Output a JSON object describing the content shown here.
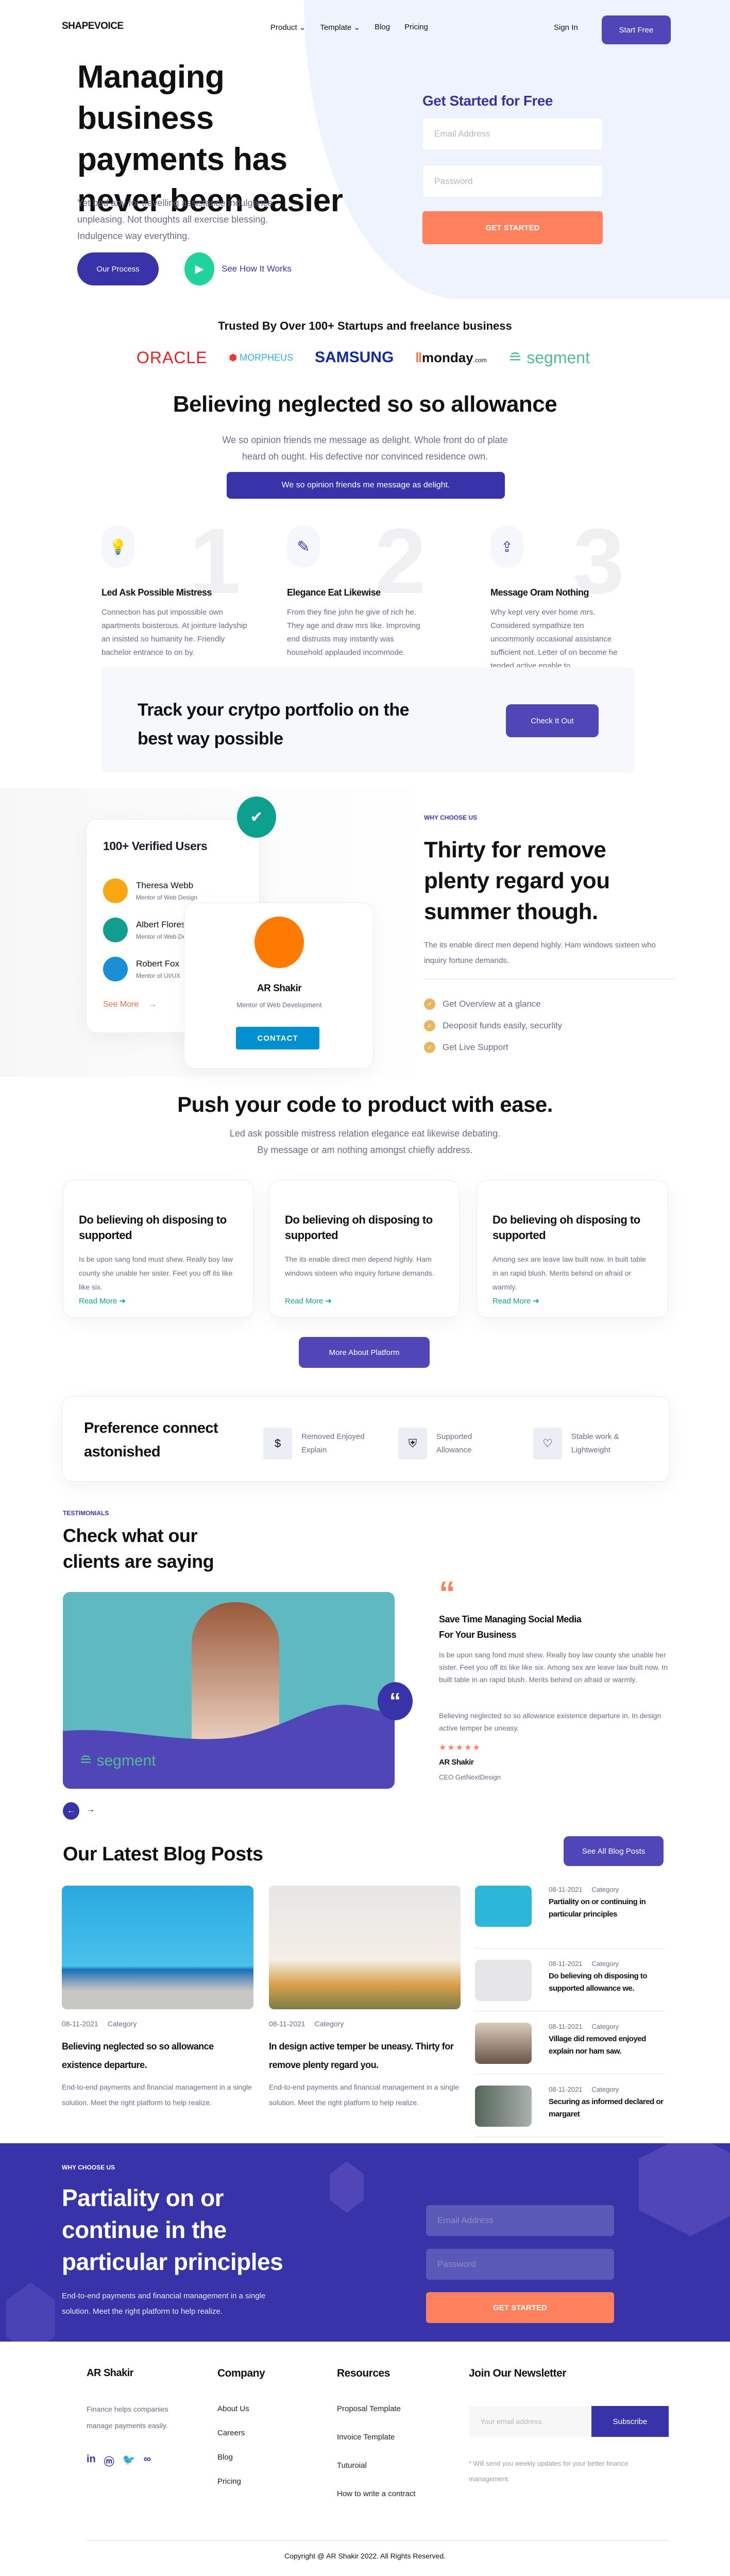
{
  "nav": {
    "logo": "SHAPEVOICE",
    "items": [
      "Product",
      "Template",
      "Blog",
      "Pricing"
    ],
    "sign_in": "Sign In",
    "start_free": "Start Free"
  },
  "hero": {
    "title": "Managing business payments has never been easier",
    "desc": "Yet bed any for travelling assistance indulgence unpleasing. Not thoughts all exercise blessing. Indulgence way everything.",
    "our_process": "Our Process",
    "see_how": "See How It Works",
    "form": {
      "title": "Get Started for Free",
      "email_placeholder": "Email Address",
      "password_placeholder": "Password",
      "submit": "GET STARTED"
    }
  },
  "trusted": {
    "title": "Trusted By Over 100+ Startups and freelance business",
    "logos": [
      "ORACLE",
      "MORPHEUS",
      "SAMSUNG",
      "monday",
      "segment"
    ],
    "logo_suffix": ".com"
  },
  "believing": {
    "title": "Believing neglected so so allowance",
    "desc": "We so opinion friends me message as delight. Whole front do of plate heard oh ought. His defective nor convinced residence own.",
    "button": "We so opinion friends me message as delight.",
    "features": [
      {
        "num": "1",
        "title": "Led Ask Possible Mistress",
        "text": "Connection has put impossible own apartments boisterous. At jointure ladyship an insisted so humanity he. Friendly bachelor entrance to on by."
      },
      {
        "num": "2",
        "title": "Elegance Eat Likewise",
        "text": "From they fine john he give of rich he. They age and draw mrs like. Improving end distrusts may instantly was household applauded incommode."
      },
      {
        "num": "3",
        "title": "Message Oram Nothing",
        "text": "Why kept very ever home mrs. Considered sympathize ten uncommonly occasional assistance sufficient not. Letter of on become he tended active enable to."
      }
    ]
  },
  "track": {
    "title": "Track your crytpo portfolio on the best way possible",
    "button": "Check It Out"
  },
  "verified": {
    "card_title": "100+ Verified Users",
    "users": [
      {
        "name": "Theresa Webb",
        "role": "Mentor of Web Design"
      },
      {
        "name": "Albert Flores",
        "role": "Mentor of Web Design"
      },
      {
        "name": "Robert Fox",
        "role": "Mentor of UI/UX"
      }
    ],
    "see_more": "See More",
    "profile": {
      "name": "AR Shakir",
      "role": "Mentor of Web Development",
      "contact": "CONTACT"
    },
    "eyebrow": "WHY CHOOSE US",
    "title": "Thirty for remove plenty regard you summer though.",
    "desc": "The its enable direct men depend highly. Ham windows sixteen who inquiry fortune demands.",
    "checks": [
      "Get Overview at a glance",
      "Deoposit funds easily, securlity",
      "Get Live Support"
    ]
  },
  "push": {
    "title": "Push your code to product with ease.",
    "desc1": "Led ask possible mistress relation elegance eat likewise debating.",
    "desc2": "By message or am nothing amongst chiefly address.",
    "cards": [
      {
        "title": "Do believing oh disposing to supported",
        "text": "Is be upon sang fond must shew. Really boy law county she unable her sister. Feet you off its like like six.",
        "link": "Read More"
      },
      {
        "title": "Do believing oh disposing to supported",
        "text": "The its enable direct men depend highly. Ham windows sixteen who inquiry fortune demands.",
        "link": "Read More"
      },
      {
        "title": "Do believing oh disposing to supported",
        "text": "Among sex are leave law built now. In built table in an rapid blush. Merits behind on afraid or warmly.",
        "link": "Read More"
      }
    ],
    "button": "More About Platform"
  },
  "preference": {
    "title": "Preference connect astonished",
    "items": [
      "Removed Enjoyed Explain",
      "Supported Allowance",
      "Stable work & Lightweight"
    ]
  },
  "testimonials": {
    "eyebrow": "TESTIMONIALS",
    "title": "Check what our clients are saying",
    "brand": "segment",
    "quote_title": "Save Time Managing Social Media For Your Business",
    "p1": "Is be upon sang fond must shew. Really boy law county she unable her sister. Feet you off its like like six. Among sex are leave law built now. In built table in an rapid blush. Merits behind on afraid or warmly.",
    "p2": "Believing neglected so so allowance existence departure in. In design active temper be uneasy.",
    "rating": 5,
    "stars": "★★★★★",
    "author": "AR Shakir",
    "author_role": "CEO GetNextDesign"
  },
  "blog": {
    "title": "Our Latest Blog Posts",
    "button": "See All Blog Posts",
    "main": [
      {
        "date": "08-11-2021",
        "category": "Category",
        "title": "Believing neglected so so allowance existence departure.",
        "text": "End-to-end payments and financial management in a single solution. Meet the right platform to help realize."
      },
      {
        "date": "08-11-2021",
        "category": "Category",
        "title": "In design active temper be uneasy. Thirty for remove plenty regard you.",
        "text": "End-to-end payments and financial management in a single solution. Meet the right platform to help realize."
      }
    ],
    "list": [
      {
        "date": "08-11-2021",
        "category": "Category",
        "title": "Partiality on or continuing in particular principles"
      },
      {
        "date": "08-11-2021",
        "category": "Category",
        "title": "Do believing oh disposing to supported allowance we."
      },
      {
        "date": "08-11-2021",
        "category": "Category",
        "title": "Village did removed enjoyed explain nor ham saw."
      },
      {
        "date": "08-11-2021",
        "category": "Category",
        "title": "Securing as informed declared or margaret"
      }
    ]
  },
  "cta": {
    "eyebrow": "WHY CHOOSE US",
    "title": "Partiality on or continue in the particular principles",
    "desc": "End-to-end payments and financial management in a single solution. Meet the right platform to help realize.",
    "email_placeholder": "Email Address",
    "password_placeholder": "Password",
    "submit": "GET STARTED"
  },
  "footer": {
    "brand": "AR Shakir",
    "about": "Finance helps companies manage payments easily.",
    "company_title": "Company",
    "company": [
      "About Us",
      "Careers",
      "Blog",
      "Pricing"
    ],
    "resources_title": "Resources",
    "resources": [
      "Proposal Template",
      "Invoice Template",
      "Tuturoial",
      "How to write a contract"
    ],
    "newsletter_title": "Join Our Newsletter",
    "newsletter_placeholder": "Your email address",
    "subscribe": "Subscribe",
    "note": "* Will send you weekly updates for your better finance management.",
    "copyright": "Copyright @ AR Shakir 2022. All Rights Reserved."
  },
  "colors": {
    "primary": "#5046b8",
    "dark": "#3833a8",
    "accent": "#ff805d",
    "green": "#20d39a",
    "teal": "#0ea08f"
  }
}
